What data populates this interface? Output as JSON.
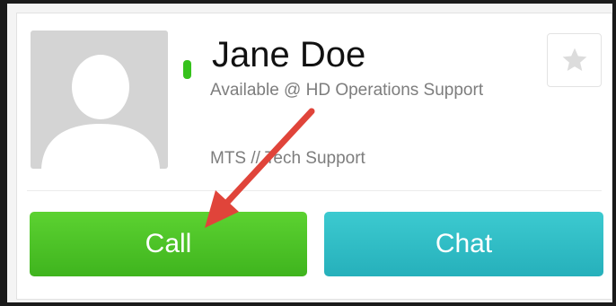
{
  "contact": {
    "name": "Jane Doe",
    "status_text": "Available @ HD Operations Support",
    "title": "MTS // Tech Support",
    "presence": "available",
    "presence_color": "#36c21c",
    "avatar_icon": "person-placeholder-icon"
  },
  "favorite": {
    "icon": "star-icon"
  },
  "actions": {
    "call_label": "Call",
    "call_color": "#45b823",
    "chat_label": "Chat",
    "chat_color": "#2bb7c1"
  },
  "annotation": {
    "arrow_color": "#e0443a"
  }
}
